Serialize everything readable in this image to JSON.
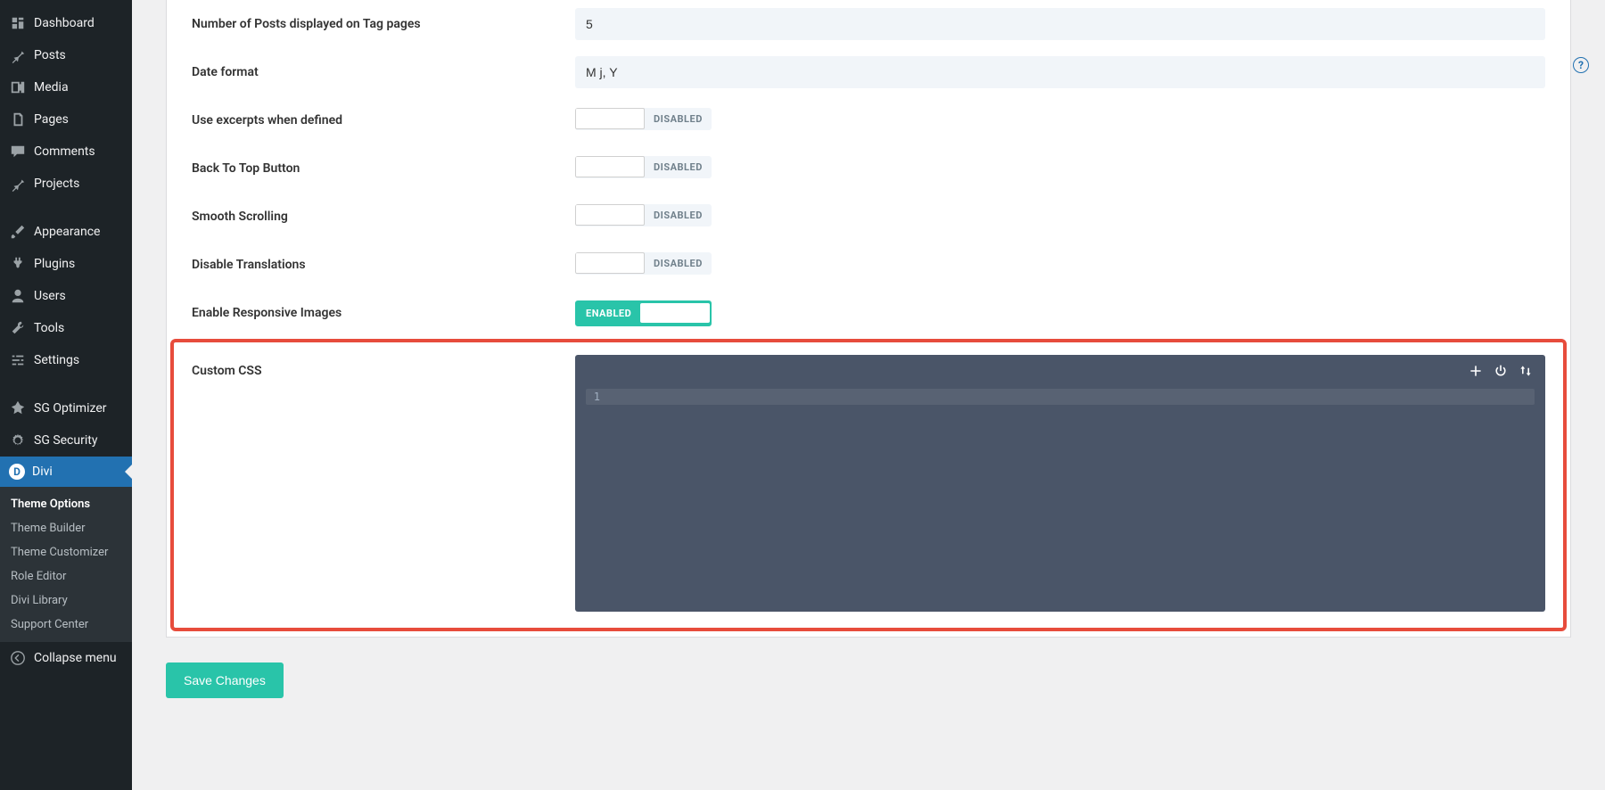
{
  "sidebar": {
    "items": [
      {
        "label": "Dashboard",
        "icon": "dashboard"
      },
      {
        "label": "Posts",
        "icon": "pin"
      },
      {
        "label": "Media",
        "icon": "media"
      },
      {
        "label": "Pages",
        "icon": "pages"
      },
      {
        "label": "Comments",
        "icon": "comment"
      },
      {
        "label": "Projects",
        "icon": "pin"
      },
      {
        "label": "Appearance",
        "icon": "brush"
      },
      {
        "label": "Plugins",
        "icon": "plug"
      },
      {
        "label": "Users",
        "icon": "user"
      },
      {
        "label": "Tools",
        "icon": "wrench"
      },
      {
        "label": "Settings",
        "icon": "sliders"
      },
      {
        "label": "SG Optimizer",
        "icon": "rocket"
      },
      {
        "label": "SG Security",
        "icon": "gear"
      },
      {
        "label": "Divi",
        "icon": "D"
      }
    ],
    "submenu": [
      "Theme Options",
      "Theme Builder",
      "Theme Customizer",
      "Role Editor",
      "Divi Library",
      "Support Center"
    ],
    "collapse": "Collapse menu"
  },
  "settings": {
    "rows": [
      {
        "label": "Number of Posts displayed on Tag pages",
        "kind": "text",
        "value": "5"
      },
      {
        "label": "Date format",
        "kind": "text",
        "value": "M j, Y"
      },
      {
        "label": "Use excerpts when defined",
        "kind": "toggle",
        "state": "DISABLED"
      },
      {
        "label": "Back To Top Button",
        "kind": "toggle",
        "state": "DISABLED"
      },
      {
        "label": "Smooth Scrolling",
        "kind": "toggle",
        "state": "DISABLED"
      },
      {
        "label": "Disable Translations",
        "kind": "toggle",
        "state": "DISABLED"
      },
      {
        "label": "Enable Responsive Images",
        "kind": "toggle",
        "state": "ENABLED"
      }
    ],
    "custom_css_label": "Custom CSS",
    "code_line_num": "1"
  },
  "save_button": "Save Changes",
  "help_tooltip": "?"
}
